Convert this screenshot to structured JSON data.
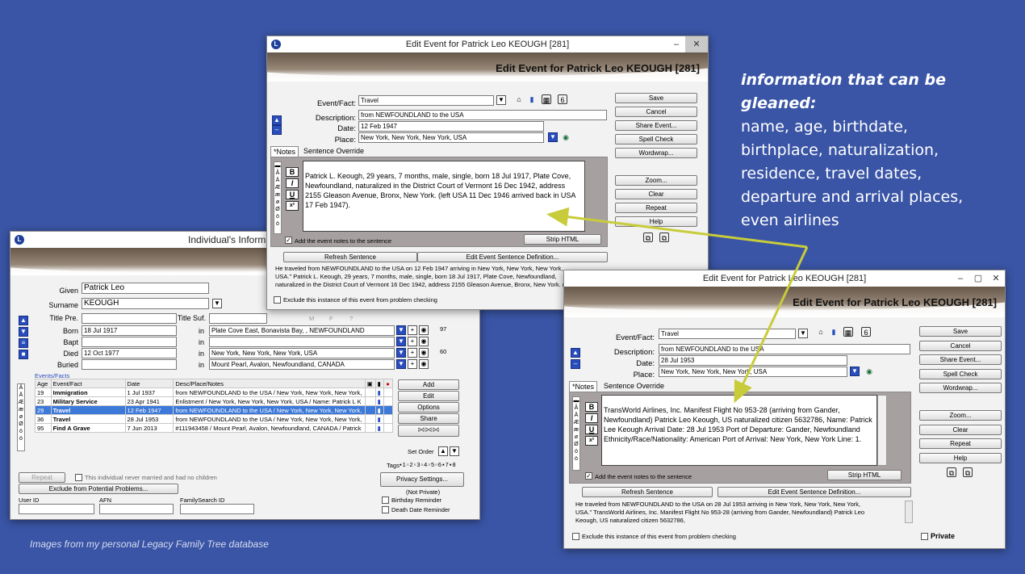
{
  "callout": {
    "heading_1": "information that can be",
    "heading_2": "gleaned:",
    "lines": [
      "name, age, birthdate,",
      "birthplace, naturalization,",
      "residence, travel dates,",
      "departure and arrival places,",
      "even airlines"
    ]
  },
  "caption": "Images from my personal Legacy Family Tree database",
  "colors": {
    "background": "#3a55a6",
    "arrow": "#c8cc3a",
    "selected_row": "#3d79d8",
    "notes_panel": "#a7a0a0"
  },
  "individual": {
    "title": "Individual's Informat",
    "labels": {
      "given": "Given",
      "surname": "Surname",
      "title_pre": "Title Pre.",
      "title_suf": "Title Suf.",
      "born": "Born",
      "bapt": "Bapt",
      "died": "Died",
      "buried": "Buried",
      "in": "in"
    },
    "given": "Patrick Leo",
    "surname": "KEOUGH",
    "born_date": "18 Jul 1917",
    "born_place": "Plate Cove East, Bonavista Bay, , NEWFOUNDLAND",
    "born_age": "97",
    "died_date": "12 Oct 1977",
    "died_place": "New York, New York, New York, USA",
    "died_age": "60",
    "buried_place": "Mount Pearl, Avalon, Newfoundland, CANADA",
    "gender": {
      "m": "M",
      "f": "F",
      "u": "?"
    },
    "events_label": "Events/Facts",
    "columns": [
      "Age",
      "Event/Fact",
      "Date",
      "Desc/Place/Notes"
    ],
    "rows": [
      {
        "age": "19",
        "event": "Immigration",
        "date": "1 Jul 1937",
        "desc": "from NEWFOUNDLAND to the USA / New York, New York, New York,"
      },
      {
        "age": "23",
        "event": "Military Service",
        "date": "23 Apr 1941",
        "desc": "Enlistment / New York, New York, New York, USA /  Name: Patrick L K"
      },
      {
        "age": "29",
        "event": "Travel",
        "date": "12 Feb 1947",
        "desc": "from NEWFOUNDLAND to the USA / New York, New York, New York,"
      },
      {
        "age": "36",
        "event": "Travel",
        "date": "28 Jul 1953",
        "desc": "from NEWFOUNDLAND to the USA / New York, New York, New York,"
      },
      {
        "age": "95",
        "event": "Find A Grave",
        "date": "7 Jun 2013",
        "desc": "#111943458 / Mount Pearl, Avalon, Newfoundland, CANADA /  Patrick"
      }
    ],
    "buttons": {
      "add": "Add",
      "edit": "Edit",
      "options": "Options",
      "share": "Share",
      "repeat": "Repeat",
      "exclude": "Exclude from Potential Problems...",
      "privacy": "Privacy Settings..."
    },
    "set_order": "Set Order",
    "tags": "Tags",
    "never_married": "This individual never married and had no children",
    "not_private": "(Not Private)",
    "birthday_reminder": "Birthday Reminder",
    "death_reminder": "Death Date Reminder",
    "user_id": "User ID",
    "afn": "AFN",
    "familysearch_id": "FamilySearch ID"
  },
  "edit1": {
    "window_title": "Edit Event for Patrick Leo KEOUGH [281]",
    "banner_title": "Edit Event for Patrick Leo KEOUGH [281]",
    "labels": {
      "event": "Event/Fact:",
      "description": "Description:",
      "date": "Date:",
      "place": "Place:"
    },
    "event": "Travel",
    "description": "from NEWFOUNDLAND to the USA",
    "date": "12 Feb 1947",
    "place": "New York, New York, New York, USA",
    "tabs": {
      "notes": "*Notes",
      "override": "Sentence Override"
    },
    "notes": "Patrick L. Keough, 29 years, 7 months, male, single, born 18 Jul 1917, Plate Cove, Newfoundland, naturalized in the District Court of Vermont 16 Dec 1942, address 2155 Gleason Avenue, Bronx, New York. (left USA 11 Dec 1946 arrived back in USA 17 Feb 1947).",
    "add_notes": "Add the event notes to the sentence",
    "strip_html": "Strip HTML",
    "refresh": "Refresh Sentence",
    "edit_def": "Edit Event Sentence Definition...",
    "sentence": "He traveled from NEWFOUNDLAND to the USA on 12 Feb 1947 arriving in New York, New York, New York, USA.\" Patrick L. Keough, 29 years, 7 months, male, single, born 18 Jul 1917, Plate Cove, Newfoundland, naturalized in the District Court of Vermont 16 Dec 1942, address 2155 Gleason Avenue, Bronx, New York. (left USA 11 Dec 1946 arrived",
    "exclude": "Exclude this instance of this event from problem checking",
    "buttons": [
      "Save",
      "Cancel",
      "Share Event...",
      "Spell Check",
      "Wordwrap...",
      "Zoom...",
      "Clear",
      "Repeat",
      "Help"
    ]
  },
  "edit2": {
    "window_title": "Edit Event for Patrick Leo KEOUGH [281]",
    "banner_title": "Edit Event for Patrick Leo KEOUGH [281]",
    "labels": {
      "event": "Event/Fact:",
      "description": "Description:",
      "date": "Date:",
      "place": "Place:"
    },
    "event": "Travel",
    "description": "from NEWFOUNDLAND to the USA",
    "date": "28 Jul 1953",
    "place": "New York, New York, New York, USA",
    "tabs": {
      "notes": "*Notes",
      "override": "Sentence Override"
    },
    "notes": "TransWorld Airlines, Inc. Manifest Flight No 953-28 (arriving from Gander, Newfoundland) Patrick Leo Keough, US naturalized citizen 5632786, Name: Patrick Lee Keough Arrival Date: 28 Jul 1953 Port of Departure: Gander, Newfoundland Ethnicity/Race/Nationality: American Port of Arrival: New York, New York Line: 1.",
    "add_notes": "Add the event notes to the sentence",
    "strip_html": "Strip HTML",
    "refresh": "Refresh Sentence",
    "edit_def": "Edit Event Sentence Definition...",
    "sentence": "He traveled from NEWFOUNDLAND to the USA on 28 Jul 1953 arriving in New York, New York, New York, USA.\" TransWorld Airlines, Inc. Manifest Flight No 953-28 (arriving from Gander, Newfoundland) Patrick Leo Keough, US naturalized citizen 5632786,",
    "exclude": "Exclude this instance of this event from problem checking",
    "private": "Private",
    "buttons": [
      "Save",
      "Cancel",
      "Share Event...",
      "Spell Check",
      "Wordwrap...",
      "Zoom...",
      "Clear",
      "Repeat",
      "Help"
    ]
  }
}
